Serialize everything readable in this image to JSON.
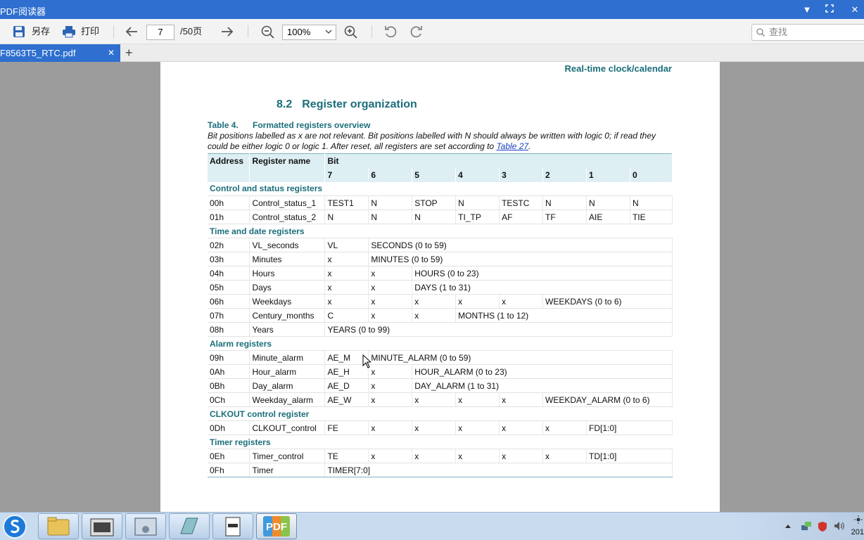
{
  "window": {
    "title": "PDF阅读器",
    "controls": {
      "minimize": "▼",
      "maximize": "⛶",
      "close": "✕"
    }
  },
  "toolbar": {
    "save_label": "另存",
    "print_label": "打印",
    "current_page": "7",
    "total_pages": "/50页",
    "zoom": "100%",
    "search_placeholder": "查找"
  },
  "tab": {
    "filename": "F8563T5_RTC.pdf",
    "close": "✕",
    "add": "+"
  },
  "document": {
    "running_head": "Real-time clock/calendar",
    "section_number": "8.2",
    "section_title": "Register organization",
    "table_number": "Table 4.",
    "table_title": "Formatted registers overview",
    "note_text": "Bit positions labelled as x are not relevant. Bit positions labelled with N should always be written with logic 0; if read they could be either logic 0 or logic 1. After reset, all registers are set according to ",
    "note_link": "Table 27",
    "note_end": ".",
    "header": {
      "address": "Address",
      "register_name": "Register name",
      "bit": "Bit",
      "bits": [
        "7",
        "6",
        "5",
        "4",
        "3",
        "2",
        "1",
        "0"
      ]
    },
    "groups": {
      "control": "Control and status registers",
      "time": "Time and date registers",
      "alarm": "Alarm registers",
      "clkout": "CLKOUT control register",
      "timer": "Timer registers"
    },
    "rows": {
      "r00": [
        "00h",
        "Control_status_1",
        "TEST1",
        "N",
        "STOP",
        "N",
        "TESTC",
        "N",
        "N",
        "N"
      ],
      "r01": [
        "01h",
        "Control_status_2",
        "N",
        "N",
        "N",
        "TI_TP",
        "AF",
        "TF",
        "AIE",
        "TIE"
      ],
      "r02": [
        "02h",
        "VL_seconds",
        "VL",
        "SECONDS (0 to 59)"
      ],
      "r03": [
        "03h",
        "Minutes",
        "x",
        "MINUTES (0 to 59)"
      ],
      "r04": [
        "04h",
        "Hours",
        "x",
        "x",
        "HOURS (0 to 23)"
      ],
      "r05": [
        "05h",
        "Days",
        "x",
        "x",
        "DAYS (1 to 31)"
      ],
      "r06": [
        "06h",
        "Weekdays",
        "x",
        "x",
        "x",
        "x",
        "x",
        "WEEKDAYS (0 to 6)"
      ],
      "r07": [
        "07h",
        "Century_months",
        "C",
        "x",
        "x",
        "MONTHS (1 to 12)"
      ],
      "r08": [
        "08h",
        "Years",
        "YEARS (0 to 99)"
      ],
      "r09": [
        "09h",
        "Minute_alarm",
        "AE_M",
        "MINUTE_ALARM (0 to 59)"
      ],
      "r0a": [
        "0Ah",
        "Hour_alarm",
        "AE_H",
        "x",
        "HOUR_ALARM (0 to 23)"
      ],
      "r0b": [
        "0Bh",
        "Day_alarm",
        "AE_D",
        "x",
        "DAY_ALARM (1 to 31)"
      ],
      "r0c": [
        "0Ch",
        "Weekday_alarm",
        "AE_W",
        "x",
        "x",
        "x",
        "x",
        "WEEKDAY_ALARM (0 to 6)"
      ],
      "r0d": [
        "0Dh",
        "CLKOUT_control",
        "FE",
        "x",
        "x",
        "x",
        "x",
        "x",
        "FD[1:0]"
      ],
      "r0e": [
        "0Eh",
        "Timer_control",
        "TE",
        "x",
        "x",
        "x",
        "x",
        "x",
        "TD[1:0]"
      ],
      "r0f": [
        "0Fh",
        "Timer",
        "TIMER[7:0]"
      ]
    }
  },
  "taskbar": {
    "clock": "201",
    "apps": [
      "folder",
      "microsoft-app",
      "control-panel",
      "notepad",
      "text-editor",
      "pdf-reader"
    ],
    "active_app_label": "PDF"
  },
  "colors": {
    "accent": "#2e6fcf",
    "heading": "#1b6e7b",
    "table_header": "#ddeff3"
  }
}
